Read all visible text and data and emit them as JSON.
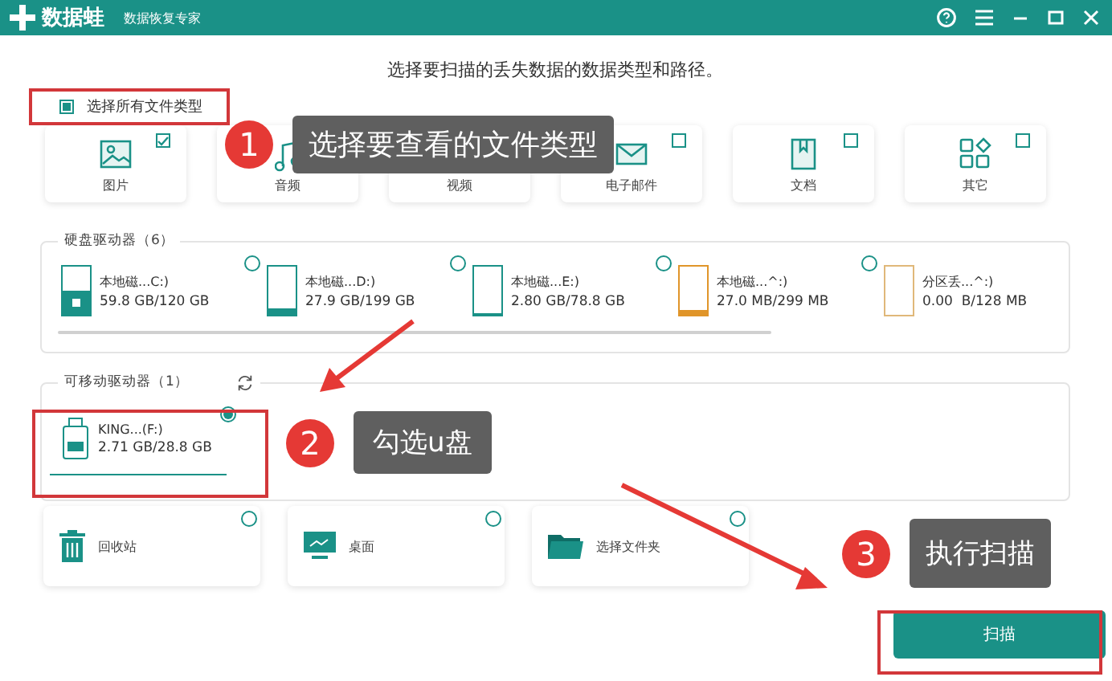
{
  "window": {
    "logo": "数据蛙",
    "subtitle": "数据恢复专家"
  },
  "heading": "选择要扫描的丢失数据的数据类型和路径。",
  "select_all": {
    "label": "选择所有文件类型",
    "checked": true
  },
  "file_types": [
    {
      "label": "图片",
      "kind": "image",
      "checked": true
    },
    {
      "label": "音频",
      "kind": "audio"
    },
    {
      "label": "视频",
      "kind": "video"
    },
    {
      "label": "电子邮件",
      "kind": "mail",
      "checked": false
    },
    {
      "label": "文档",
      "kind": "document",
      "checked": false
    },
    {
      "label": "其它",
      "kind": "other",
      "checked": false
    }
  ],
  "hard_drives": {
    "title": "硬盘驱动器（6）",
    "drives": [
      {
        "name": "本地磁...C:)",
        "size": "59.8 GB/120 GB",
        "kind": "system",
        "level": 0.5,
        "color": "#1a9187",
        "selected": false
      },
      {
        "name": "本地磁...D:)",
        "size": "27.9 GB/199 GB",
        "kind": "volume",
        "level": 0.14,
        "color": "#1a9187",
        "selected": false
      },
      {
        "name": "本地磁...E:)",
        "size": "2.80 GB/78.8 GB",
        "kind": "volume",
        "level": 0.04,
        "color": "#1a9187",
        "selected": false
      },
      {
        "name": "本地磁...^:)",
        "size": "27.0 MB/299 MB",
        "kind": "volume",
        "level": 0.09,
        "color": "#e0952a",
        "selected": false
      },
      {
        "name": "分区丢...^:)",
        "size": "0.00  B/128 MB",
        "kind": "volume",
        "color": "#e0b87a"
      }
    ]
  },
  "removable_drives": {
    "title": "可移动驱动器（1）",
    "drives": [
      {
        "name": "KING...(F:)",
        "size": "2.71 GB/28.8 GB",
        "selected": true
      }
    ]
  },
  "locations": [
    {
      "label": "回收站",
      "kind": "trash",
      "selected": false
    },
    {
      "label": "桌面",
      "kind": "desktop",
      "selected": false
    },
    {
      "label": "选择文件夹",
      "kind": "folder",
      "selected": false
    }
  ],
  "scan_button": "扫描",
  "annotations": [
    {
      "number": "1",
      "text": "选择要查看的文件类型"
    },
    {
      "number": "2",
      "text": "勾选u盘"
    },
    {
      "number": "3",
      "text": "执行扫描"
    }
  ]
}
